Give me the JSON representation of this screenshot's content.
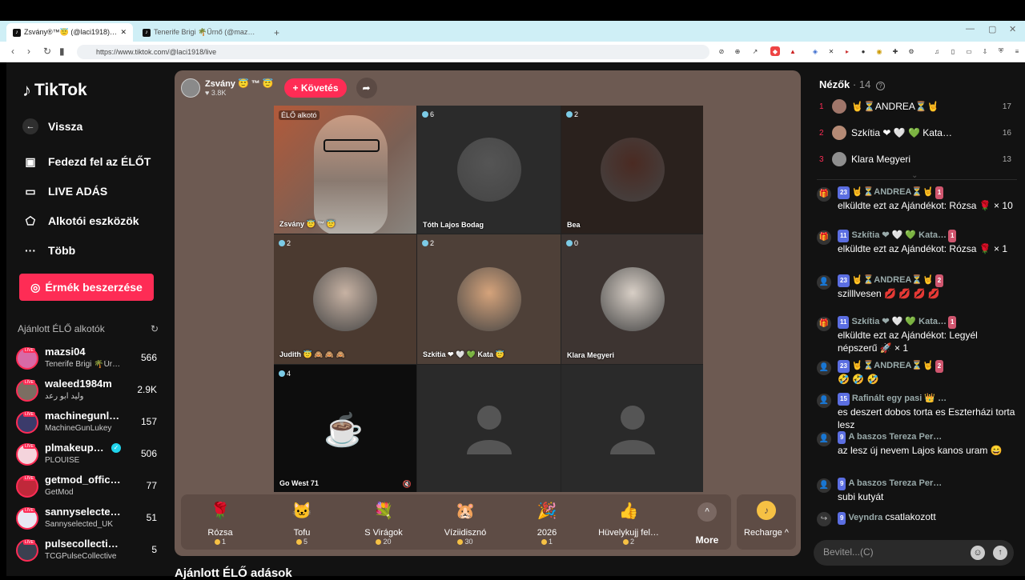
{
  "browser": {
    "tabs": [
      {
        "title": "Zsvány®™😇 (@laci1918) Él…",
        "close": "✕"
      },
      {
        "title": "Tenerife Brigi 🌴Űrnő (@mazsi04) É…"
      }
    ],
    "new_tab": "+",
    "url": "https://www.tiktok.com/@laci1918/live",
    "window_controls": [
      "—",
      "▢",
      "✕"
    ]
  },
  "sidebar": {
    "logo": "TikTok",
    "back": "Vissza",
    "nav": [
      {
        "label": "Fedezd fel az ÉLŐT",
        "icon": "explore-live-icon"
      },
      {
        "label": "LIVE ADÁS",
        "icon": "camera-icon"
      },
      {
        "label": "Alkotói eszközök",
        "icon": "creator-tools-icon"
      },
      {
        "label": "Több",
        "icon": "more-dots-icon"
      }
    ],
    "coins_button": "Érmék beszerzése",
    "recommended_title": "Ajánlott ÉLŐ alkotók",
    "live_tag": "LIVE",
    "recommended": [
      {
        "name": "mazsi04",
        "sub": "Tenerife Brigi 🌴Űr…",
        "count": "566",
        "color": "#d86aa6"
      },
      {
        "name": "waleed1984m",
        "sub": "وليد ابو رعد",
        "count": "2.9K",
        "color": "#7b6e62"
      },
      {
        "name": "machinegunl…",
        "sub": "MachineGunLukey",
        "count": "157",
        "color": "#3b3b6b"
      },
      {
        "name": "plmakeup…",
        "sub": "PLOUISE",
        "count": "506",
        "color": "#f4d4dc",
        "verified": true
      },
      {
        "name": "getmod_offic…",
        "sub": "GetMod",
        "count": "77",
        "color": "#c0283a"
      },
      {
        "name": "sannyselecte…",
        "sub": "Sannyselected_UK",
        "count": "51",
        "color": "#e8e8f2"
      },
      {
        "name": "pulsecollecti…",
        "sub": "TCGPulseCollective",
        "count": "5",
        "color": "#3a4050"
      }
    ]
  },
  "stream": {
    "host_name": "Zsvány 😇 ™ 😇",
    "host_likes": "♥ 3.8K",
    "follow": "+ Követés",
    "share_icon": "share-icon",
    "tiles": [
      {
        "name": "Zsvány 😇 ™ 😇",
        "badge": "ÉLŐ alkotó",
        "bg": "#8a6a55",
        "face": "#9f8877"
      },
      {
        "name": "Tóth Lajos Bodag",
        "badge": "6",
        "bg": "#2b2b2b",
        "face": "#555"
      },
      {
        "name": "Bea",
        "badge": "2",
        "bg": "#2a211d",
        "face": "#4a2a22"
      },
      {
        "name": "Judith 😇 🙈 🙈 🙈",
        "badge": "2",
        "bg": "#4b3a30",
        "face": "#c7b2a3"
      },
      {
        "name": "Szkítia ❤ 🤍 💚 Kata 😇",
        "badge": "2",
        "bg": "#4e4038",
        "face": "#d5a37b"
      },
      {
        "name": "Klara Megyeri",
        "badge": "0",
        "bg": "#3d3431",
        "face": "#d8cfc6"
      },
      {
        "name": "Go West 71",
        "badge": "4",
        "bg": "#0d0d0d",
        "face": ""
      },
      {
        "name": "",
        "badge": "",
        "bg": "#2a2a2a",
        "face": ""
      },
      {
        "name": "",
        "badge": "",
        "bg": "#2a2a2a",
        "face": ""
      }
    ],
    "mute_icon": "🔇"
  },
  "gifts": [
    {
      "name": "Rózsa",
      "price": "1",
      "icon": "🌹"
    },
    {
      "name": "Tofu",
      "price": "5",
      "icon": "🐱"
    },
    {
      "name": "S Virágok",
      "price": "20",
      "icon": "💐"
    },
    {
      "name": "Víziidisznó",
      "price": "30",
      "icon": "🐹"
    },
    {
      "name": "2026",
      "price": "1",
      "icon": "🎉"
    },
    {
      "name": "Hüvelykujj fel…",
      "price": "2",
      "icon": "👍"
    }
  ],
  "more": "More",
  "more_icon": "^",
  "recharge": "Recharge ^",
  "recharge_icon": "♪",
  "bottom_title": "Ajánlott ÉLŐ adások",
  "viewers": {
    "title": "Nézők",
    "count": "· 14",
    "help_icon": "?",
    "list": [
      {
        "rank": "1",
        "name": "🤘⏳ANDREA⏳🤘",
        "count": "17"
      },
      {
        "rank": "2",
        "name": "Szkítia ❤ 🤍 💚 Kata…",
        "count": "16"
      },
      {
        "rank": "3",
        "name": "Klara Megyeri",
        "count": "13"
      }
    ],
    "collapse": "⌄"
  },
  "chat": [
    {
      "icon": "🎁",
      "lvl": "23",
      "head": "🤘⏳ANDREA⏳🤘",
      "fan": "1",
      "text": "elküldte ezt az Ajándékot: Rózsa 🌹 × 10"
    },
    {
      "icon": "🎁",
      "lvl": "11",
      "head": "Szkítia ❤ 🤍 💚 Kata…",
      "fan": "1",
      "text": "elküldte ezt az Ajándékot: Rózsa 🌹 × 1"
    },
    {
      "icon": "👤",
      "lvl": "23",
      "head": "🤘⏳ANDREA⏳🤘",
      "fan": "2",
      "text": "szilllvesen 💋 💋 💋 💋"
    },
    {
      "icon": "🎁",
      "lvl": "11",
      "head": "Szkítia ❤ 🤍 💚 Kata…",
      "fan": "1",
      "text": "elküldte ezt az Ajándékot: Legyél népszerű 🚀 × 1"
    },
    {
      "icon": "👤",
      "lvl": "23",
      "head": "🤘⏳ANDREA⏳🤘",
      "fan": "2",
      "text": "🤣 🤣 🤣"
    },
    {
      "icon": "👤",
      "lvl": "15",
      "head": "Rafinált egy pasi 👑 …",
      "fan": "",
      "text": "es deszert dobos torta es Eszterházi torta lesz"
    },
    {
      "icon": "👤",
      "lvl": "9",
      "head": "A baszos Tereza Per…",
      "fan": "",
      "text": "az lesz új nevem Lajos kanos uram 😄"
    },
    {
      "icon": "👤",
      "lvl": "9",
      "head": "A baszos Tereza Per…",
      "fan": "",
      "text": "subi kutyát"
    },
    {
      "icon": "↪",
      "lvl": "9",
      "head": "Veyndra",
      "fan": "",
      "text": "csatlakozott"
    }
  ],
  "input": {
    "placeholder": "Bevitel...(C)",
    "emoji": "☺",
    "send": "↑"
  }
}
